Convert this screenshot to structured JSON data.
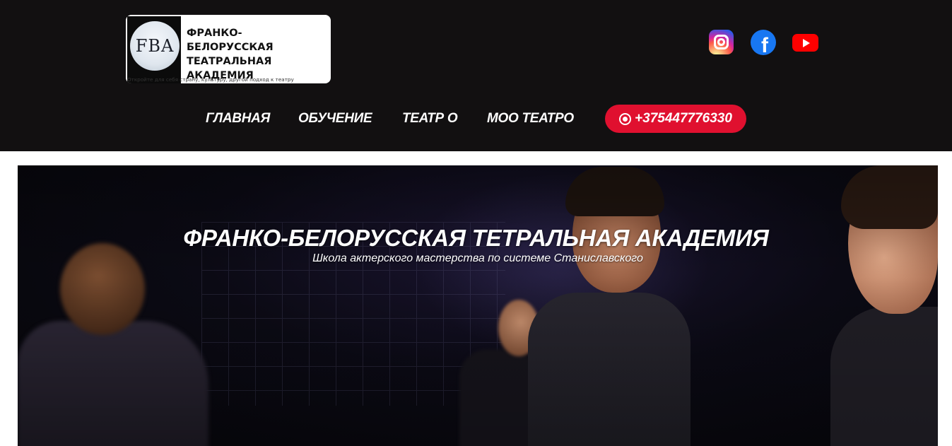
{
  "logo": {
    "mark_text": "FBA",
    "title_line1": "ФРАНКО-",
    "title_line2": "БЕЛОРУССКАЯ",
    "title_line3": "ТЕАТРАЛЬНАЯ АКАДЕМИЯ",
    "tagline": "Откройте для себя страну, культуру, другой подход к театру"
  },
  "social": [
    {
      "name": "instagram",
      "icon": "instagram-icon"
    },
    {
      "name": "facebook",
      "icon": "facebook-icon",
      "glyph": "f"
    },
    {
      "name": "youtube",
      "icon": "youtube-icon"
    }
  ],
  "nav": {
    "items": [
      {
        "label": "ГЛАВНАЯ"
      },
      {
        "label": "ОБУЧЕНИЕ"
      },
      {
        "label": "ТЕАТР О"
      },
      {
        "label": "МОО ТЕАТРО"
      }
    ],
    "phone": "+375447776330",
    "phone_icon": "whatsapp-icon"
  },
  "hero": {
    "title": "ФРАНКО-БЕЛОРУССКАЯ ТЕТРАЛЬНАЯ АКАДЕМИЯ",
    "subtitle": "Школа актерского мастерства по системе Станиславского"
  },
  "colors": {
    "header_bg": "#121011",
    "accent": "#e0102f",
    "nav_text": "#ffffff"
  }
}
